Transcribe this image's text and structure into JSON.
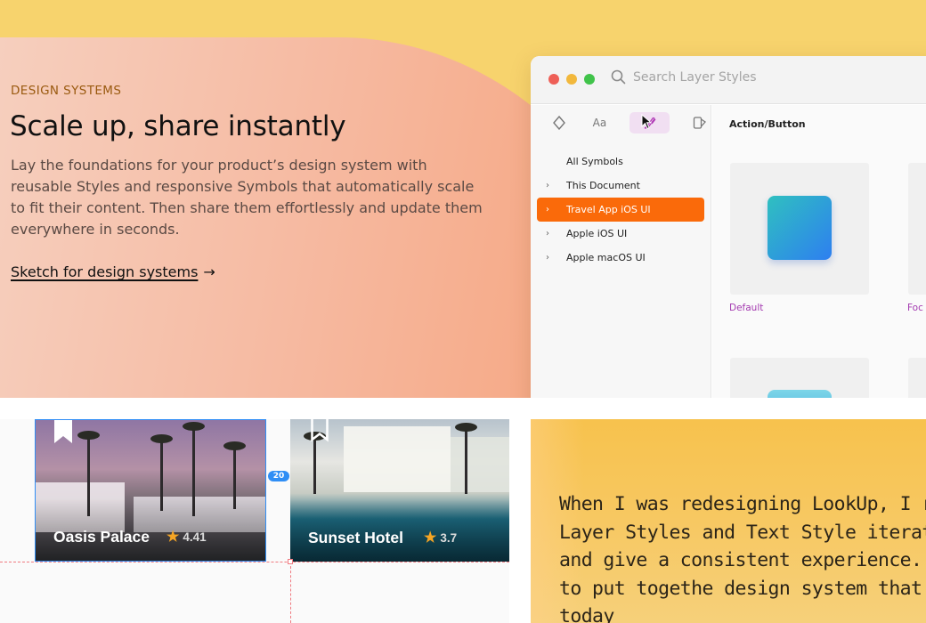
{
  "hero": {
    "eyebrow": "DESIGN SYSTEMS",
    "headline": "Scale up, share instantly",
    "body": "Lay the foundations for your product’s design system with reusable Styles and responsive Symbols that automatically scale to fit their content. Then share them effortlessly and update them everywhere in seconds.",
    "cta_label": "Sketch for design systems",
    "cta_arrow": "→"
  },
  "app_window": {
    "search_placeholder": "Search Layer Styles",
    "tabs": [
      {
        "icon": "symbol-diamond-icon",
        "glyph": "◇"
      },
      {
        "icon": "text-styles-icon",
        "glyph": "Aa"
      },
      {
        "icon": "layer-styles-brush-icon",
        "glyph": "✒",
        "active": true
      },
      {
        "icon": "color-variables-icon",
        "glyph": "◧"
      }
    ],
    "symbol_list": [
      {
        "label": "All Symbols",
        "chevron": ""
      },
      {
        "label": "This Document",
        "chevron": "›"
      },
      {
        "label": "Travel App iOS UI",
        "chevron": "›",
        "selected": true
      },
      {
        "label": "Apple iOS UI",
        "chevron": "›"
      },
      {
        "label": "Apple macOS UI",
        "chevron": "›"
      }
    ],
    "section_title": "Action/Button",
    "tiles": [
      {
        "label": "Default"
      },
      {
        "label": "Foc"
      }
    ],
    "accent_color": "#fa6a0a"
  },
  "cards": [
    {
      "name": "Oasis Palace",
      "rating": "4.41"
    },
    {
      "name": "Sunset Hotel",
      "rating": "3.7"
    }
  ],
  "spacing_badge": "20",
  "quote": {
    "text": "When I was redesigning LookUp, I re Symbols, Layer Styles and Text Style iterate faster and give a consistent experience. I was able to put togethe design system that I still use today"
  },
  "colors": {
    "hero_background": "#f7d36d",
    "selection_blue": "#2f8ef5",
    "guide_red": "#f07a80"
  }
}
